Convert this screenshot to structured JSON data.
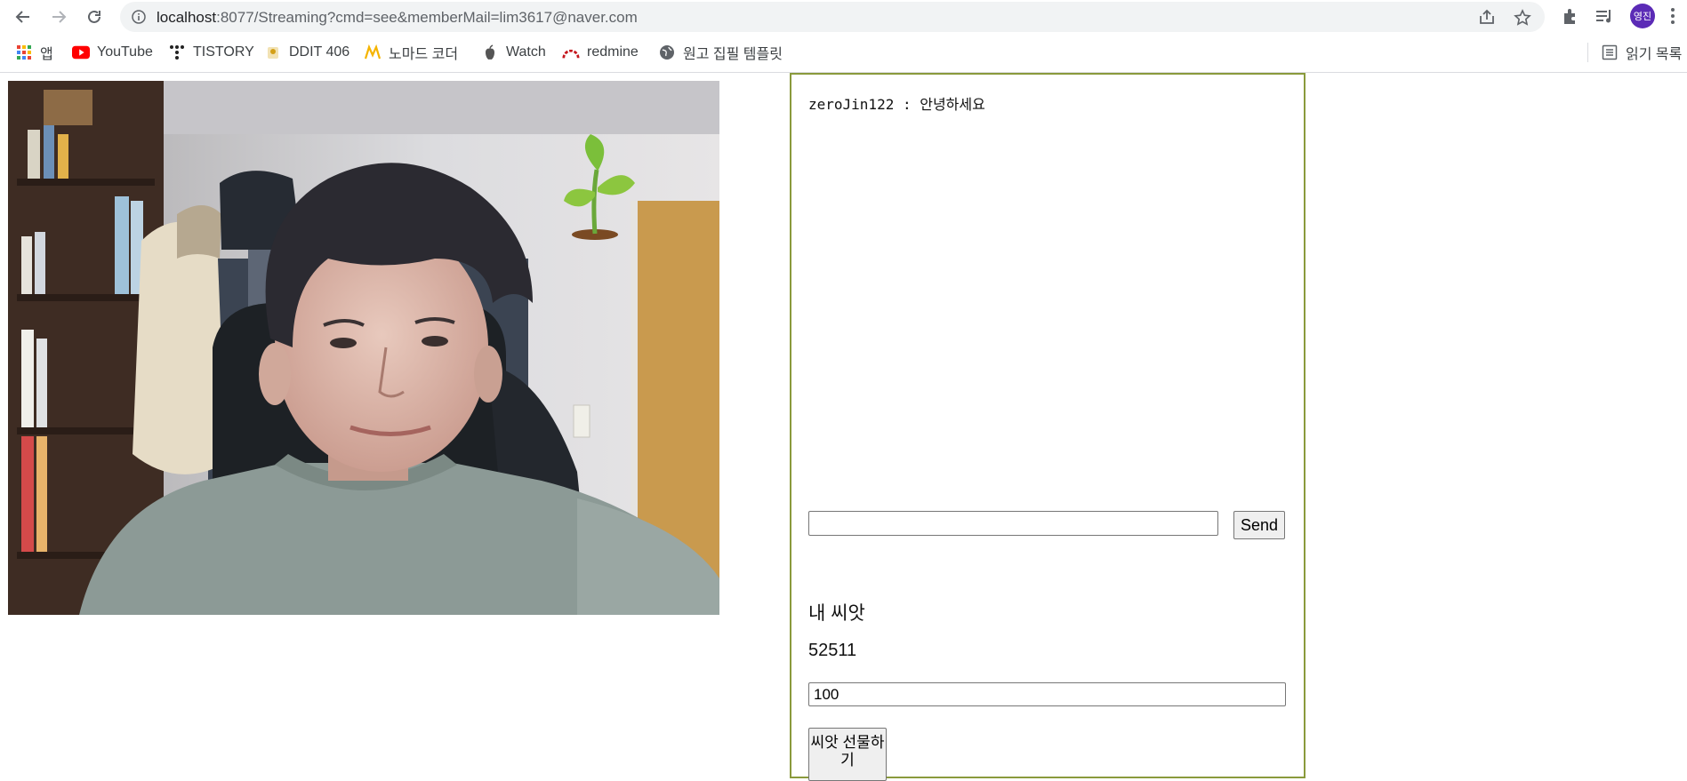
{
  "browser": {
    "url_host": "localhost",
    "url_rest": ":8077/Streaming?cmd=see&memberMail=lim3617@naver.com",
    "profile_initials": "영진"
  },
  "bookmarks": [
    {
      "label": "앱",
      "icon": "apps-grid-icon"
    },
    {
      "label": "YouTube",
      "icon": "youtube-icon"
    },
    {
      "label": "TISTORY",
      "icon": "tistory-icon"
    },
    {
      "label": "DDIT 406",
      "icon": "ddit-icon"
    },
    {
      "label": "노마드 코더",
      "icon": "nomad-icon"
    },
    {
      "label": "Watch",
      "icon": "apple-icon"
    },
    {
      "label": "redmine",
      "icon": "redmine-icon"
    },
    {
      "label": "원고 집필 템플릿",
      "icon": "globe-icon"
    }
  ],
  "reading_list_label": "읽기 목록",
  "chat": {
    "messages": [
      {
        "text": "zeroJin122 : 안녕하세요"
      }
    ],
    "input_value": "",
    "send_label": "Send"
  },
  "seed": {
    "label": "내 씨앗",
    "count": "52511",
    "gift_amount": "100",
    "gift_button_label": "씨앗 선물하기"
  },
  "colors": {
    "panel_border": "#8a9a3c",
    "avatar_bg": "#5b2bb6"
  }
}
